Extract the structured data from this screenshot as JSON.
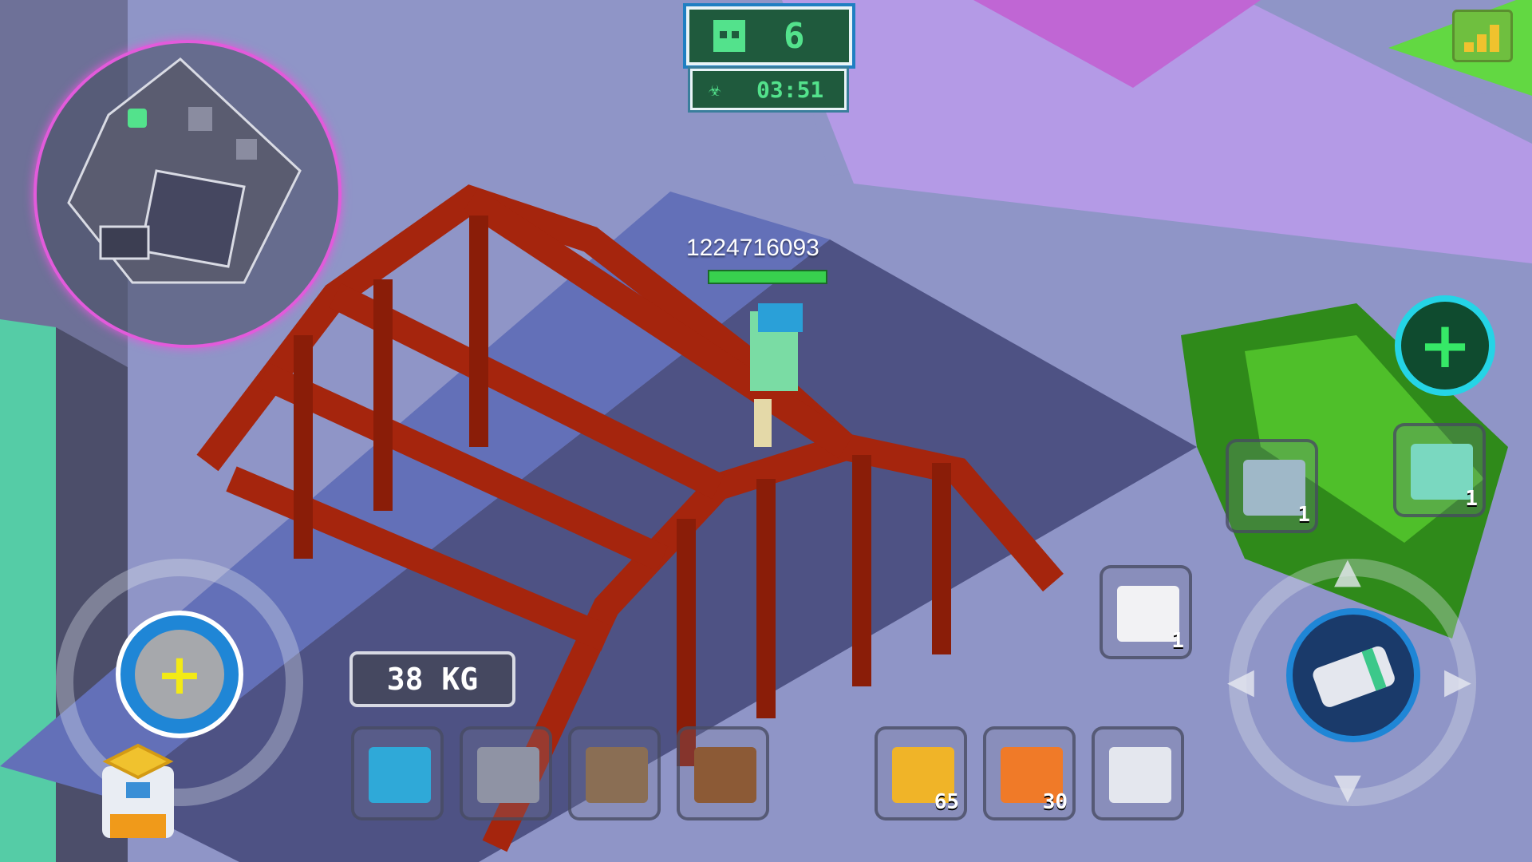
{
  "hud": {
    "alive_count": "6",
    "timer": "03:51",
    "timer_icon": "biohazard-icon",
    "player_name": "1224716093",
    "player_health_fraction": 1.0,
    "weight": "38 KG"
  },
  "slots": [
    {
      "name": "armor-slot",
      "icon": "armor-vest-icon",
      "count": ""
    },
    {
      "name": "helmet-slot",
      "icon": "helmet-icon",
      "count": ""
    },
    {
      "name": "head-gear-slot",
      "icon": "headgear-icon",
      "count": ""
    },
    {
      "name": "boots-slot",
      "icon": "boots-icon",
      "count": ""
    }
  ],
  "weapons": [
    {
      "name": "weapon-slot-1",
      "icon": "pistol-icon",
      "count": "65"
    },
    {
      "name": "weapon-slot-2",
      "icon": "smg-icon",
      "count": "30"
    },
    {
      "name": "weapon-slot-3",
      "icon": "battery-icon",
      "count": ""
    }
  ],
  "consumables": {
    "medkit_count": "1",
    "tablet_count": "1",
    "armor_kit_count": "1"
  },
  "colors": {
    "hud_green": "#53e28c",
    "minimap_ring": "#e25bdb",
    "bridge_red": "#a52a10",
    "heal_cyan": "#25d4e6"
  }
}
